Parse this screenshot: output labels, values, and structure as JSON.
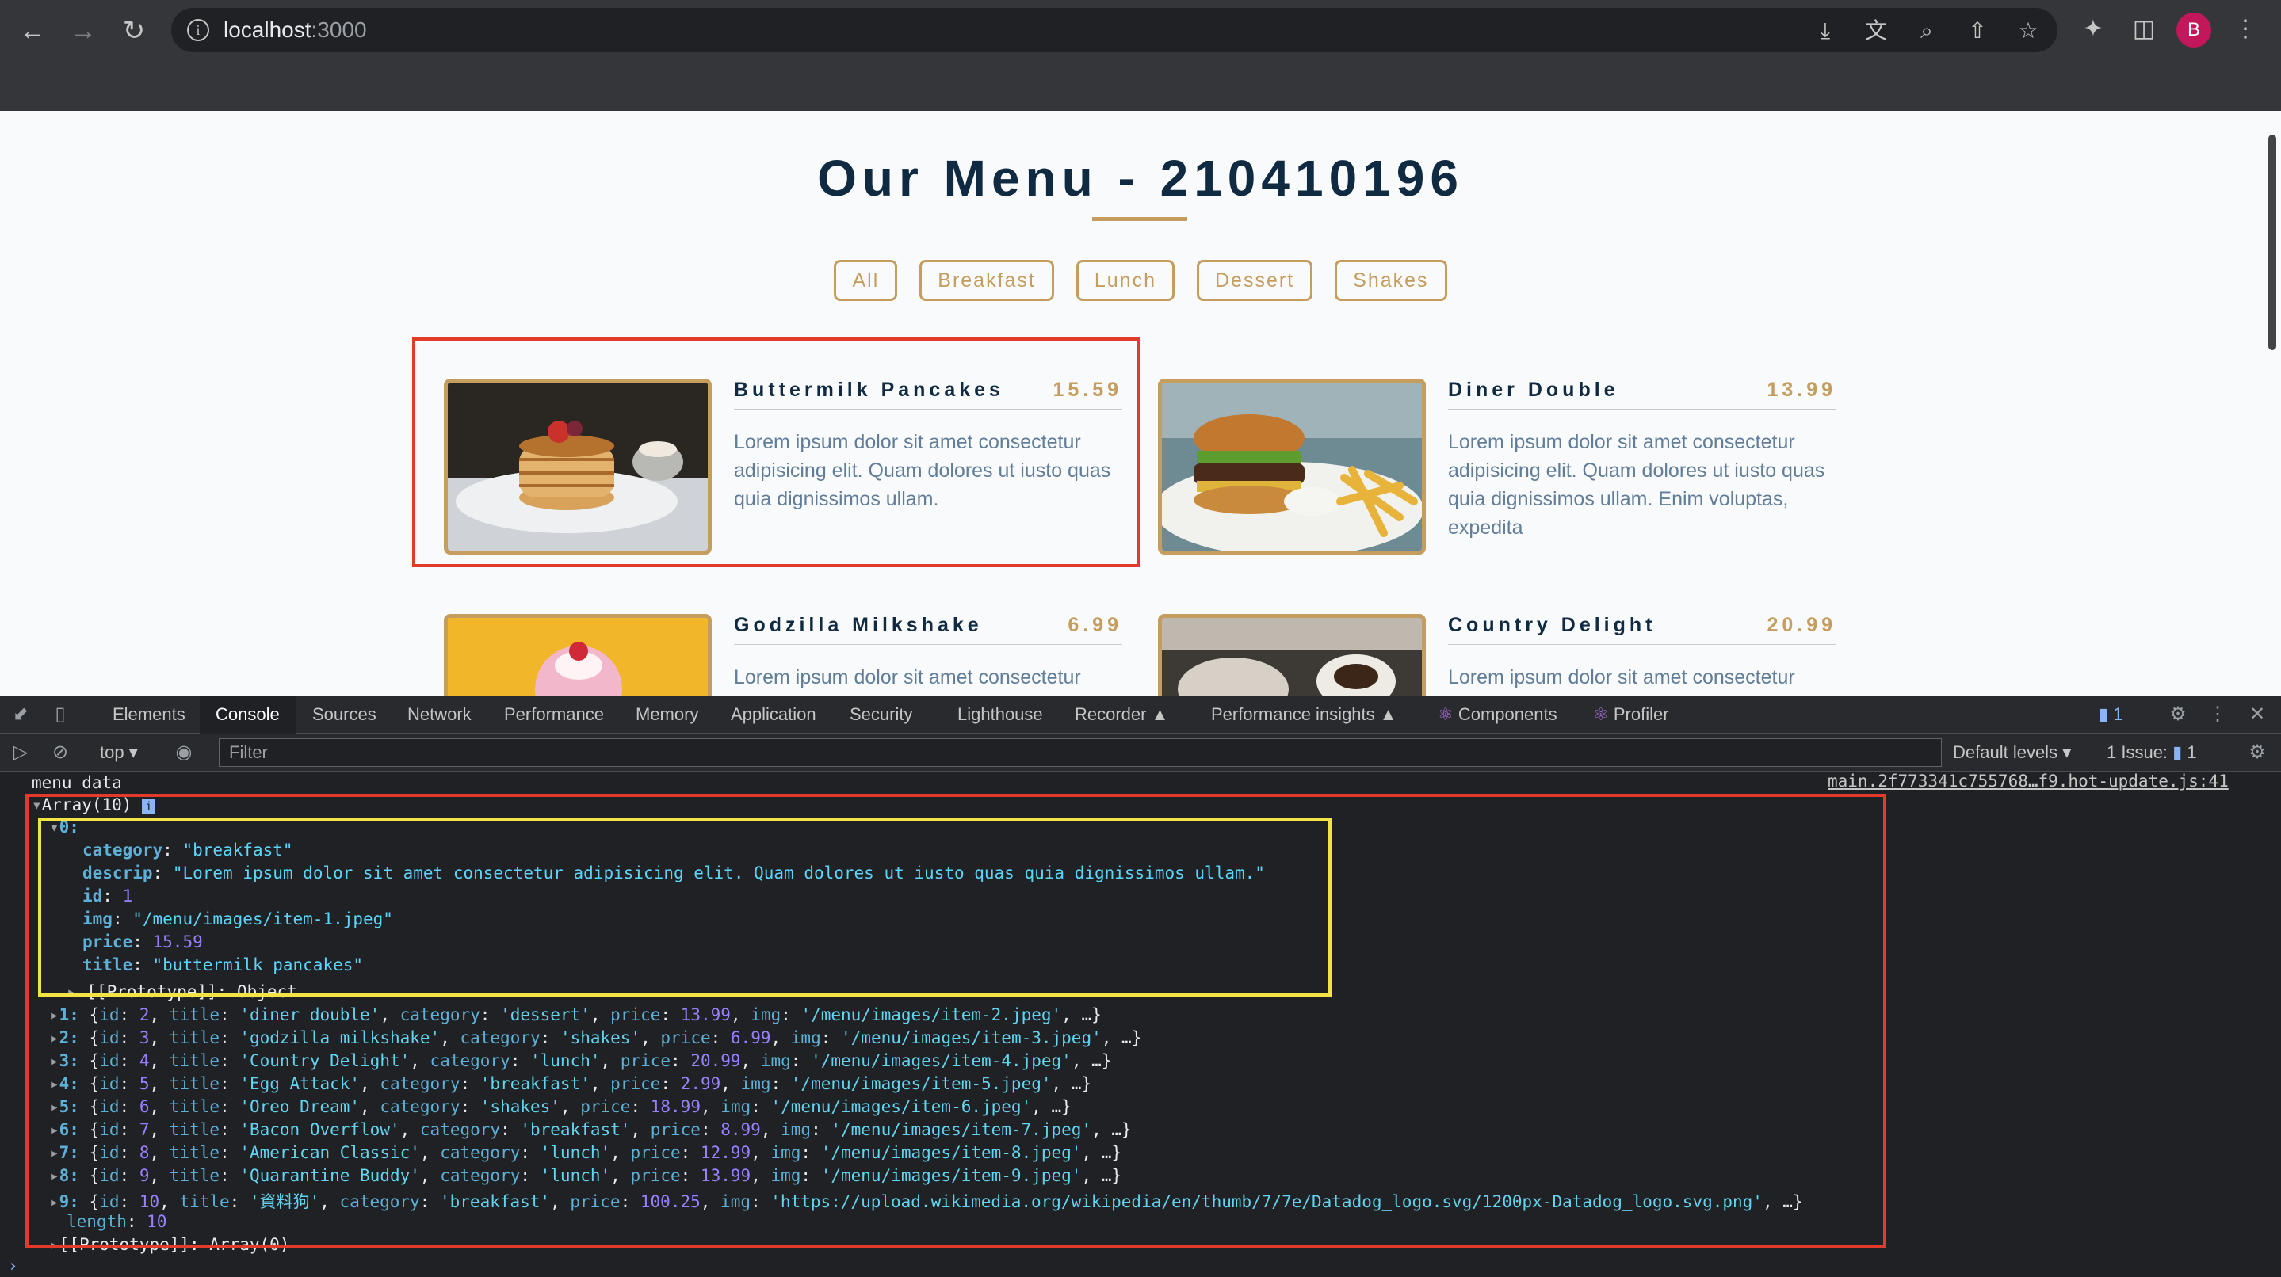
{
  "browser": {
    "url_host": "localhost",
    "url_port": ":3000",
    "avatar_letter": "B",
    "icons": [
      "back-arrow-icon",
      "forward-arrow-icon",
      "reload-icon",
      "info-icon",
      "install-icon",
      "translate-icon",
      "zoom-icon",
      "share-icon",
      "star-icon",
      "puzzle-icon",
      "side-panel-icon",
      "kebab-menu-icon"
    ]
  },
  "page": {
    "title": "Our Menu - 210410196",
    "filters": [
      "All",
      "Breakfast",
      "Lunch",
      "Dessert",
      "Shakes"
    ],
    "items": [
      {
        "title": "Buttermilk Pancakes",
        "price": "15.59",
        "desc": "Lorem ipsum dolor sit amet consectetur adipisicing elit. Quam dolores ut iusto quas quia dignissimos ullam."
      },
      {
        "title": "Diner Double",
        "price": "13.99",
        "desc": "Lorem ipsum dolor sit amet consectetur adipisicing elit. Quam dolores ut iusto quas quia dignissimos ullam. Enim voluptas, expedita"
      },
      {
        "title": "Godzilla Milkshake",
        "price": "6.99",
        "desc": "Lorem ipsum dolor sit amet consectetur"
      },
      {
        "title": "Country Delight",
        "price": "20.99",
        "desc": "Lorem ipsum dolor sit amet consectetur"
      }
    ],
    "colors": {
      "accent": "#c59d5f",
      "heading": "#102a42",
      "text": "#617d98",
      "annotation_red": "#e23b2b",
      "annotation_yellow": "#f3e344"
    }
  },
  "devtools": {
    "tabs": [
      "Elements",
      "Console",
      "Sources",
      "Network",
      "Performance",
      "Memory",
      "Application",
      "Security",
      "Lighthouse",
      "Recorder",
      "Performance insights",
      "Components",
      "Profiler"
    ],
    "active_tab": "Console",
    "messages_badge": "1",
    "context": "top",
    "filter_placeholder": "Filter",
    "levels": "Default levels",
    "issues_label": "1 Issue:",
    "issues_count": "1"
  },
  "console": {
    "log_label": "menu data",
    "source_link": "main.2f773341c755768…f9.hot-update.js:41",
    "array_label": "Array(10)",
    "expanded_index": "0:",
    "expanded_fields": [
      {
        "key": "category",
        "value": "\"breakfast\"",
        "type": "string"
      },
      {
        "key": "descrip",
        "value": "\"Lorem ipsum dolor sit amet consectetur adipisicing elit. Quam dolores ut iusto quas quia dignissimos ullam.\"",
        "type": "string"
      },
      {
        "key": "id",
        "value": "1",
        "type": "number"
      },
      {
        "key": "img",
        "value": "\"/menu/images/item-1.jpeg\"",
        "type": "string"
      },
      {
        "key": "price",
        "value": "15.59",
        "type": "number"
      },
      {
        "key": "title",
        "value": "\"buttermilk pancakes\"",
        "type": "string"
      }
    ],
    "object_prototype": "[[Prototype]]: Object",
    "rows": [
      {
        "idx": "1:",
        "id": "2",
        "title": "'diner double'",
        "category": "'dessert'",
        "price": "13.99",
        "img": "'/menu/images/item-2.jpeg'"
      },
      {
        "idx": "2:",
        "id": "3",
        "title": "'godzilla milkshake'",
        "category": "'shakes'",
        "price": "6.99",
        "img": "'/menu/images/item-3.jpeg'"
      },
      {
        "idx": "3:",
        "id": "4",
        "title": "'Country Delight'",
        "category": "'lunch'",
        "price": "20.99",
        "img": "'/menu/images/item-4.jpeg'"
      },
      {
        "idx": "4:",
        "id": "5",
        "title": "'Egg Attack'",
        "category": "'breakfast'",
        "price": "2.99",
        "img": "'/menu/images/item-5.jpeg'"
      },
      {
        "idx": "5:",
        "id": "6",
        "title": "'Oreo Dream'",
        "category": "'shakes'",
        "price": "18.99",
        "img": "'/menu/images/item-6.jpeg'"
      },
      {
        "idx": "6:",
        "id": "7",
        "title": "'Bacon Overflow'",
        "category": "'breakfast'",
        "price": "8.99",
        "img": "'/menu/images/item-7.jpeg'"
      },
      {
        "idx": "7:",
        "id": "8",
        "title": "'American Classic'",
        "category": "'lunch'",
        "price": "12.99",
        "img": "'/menu/images/item-8.jpeg'"
      },
      {
        "idx": "8:",
        "id": "9",
        "title": "'Quarantine Buddy'",
        "category": "'lunch'",
        "price": "13.99",
        "img": "'/menu/images/item-9.jpeg'"
      },
      {
        "idx": "9:",
        "id": "10",
        "title": "'資料狗'",
        "category": "'breakfast'",
        "price": "100.25",
        "img": "'https://upload.wikimedia.org/wikipedia/en/thumb/7/7e/Datadog_logo.svg/1200px-Datadog_logo.svg.png'"
      }
    ],
    "length_key": "length",
    "length_value": "10",
    "array_prototype": "[[Prototype]]: Array(0)"
  }
}
